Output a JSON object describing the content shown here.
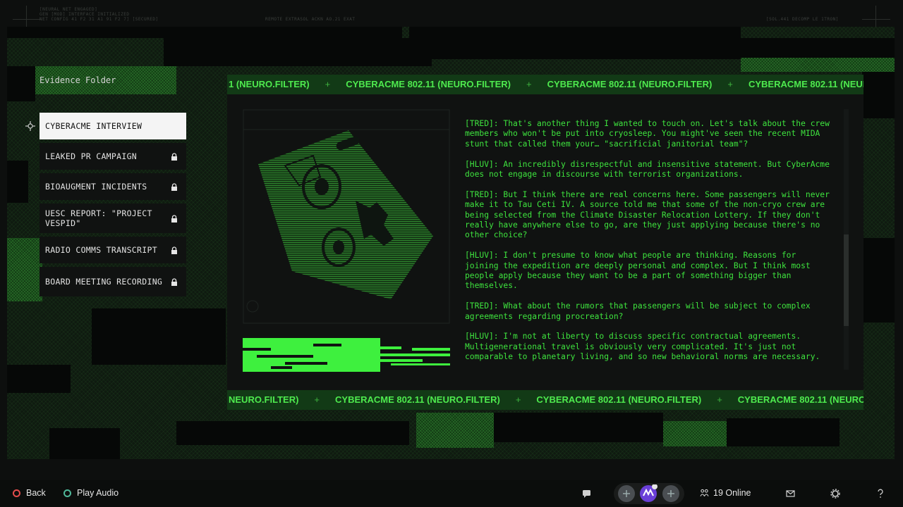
{
  "header": {
    "meta_left": [
      "[NEURAL NET ENGAGED]",
      "GEN [MOD] INTERFACE INITIALIZED",
      "NET CONFIG 41 F2 31 A1 91 F2 7]  [SECURED]"
    ],
    "meta_center": "REMOTE EXTRASOL ACKN AO.21 EXAT",
    "meta_right": "[SOL.441 DECOMP LE 1TRON]"
  },
  "sidebar": {
    "title": "Evidence Folder",
    "items": [
      {
        "label": "CYBERACME INTERVIEW",
        "active": true,
        "locked": false
      },
      {
        "label": "LEAKED PR CAMPAIGN",
        "active": false,
        "locked": true
      },
      {
        "label": "BIOAUGMENT INCIDENTS",
        "active": false,
        "locked": true
      },
      {
        "label": "UESC REPORT: \"PROJECT VESPID\"",
        "active": false,
        "locked": true
      },
      {
        "label": "RADIO COMMS TRANSCRIPT",
        "active": false,
        "locked": true
      },
      {
        "label": "BOARD MEETING RECORDING",
        "active": false,
        "locked": true
      }
    ]
  },
  "ticker": {
    "text": "CYBERACME 802.11 (NEURO.FILTER)",
    "separator": "+"
  },
  "transcript": {
    "paragraphs": [
      "[TRED]: That's another thing I wanted to touch on. Let's talk about the crew members who won't be put into cryosleep. You might've seen the recent MIDA stunt that called them your… \"sacrificial janitorial team\"?",
      "[HLUV]: An incredibly disrespectful and insensitive statement. But CyberAcme does not engage in discourse with terrorist organizations.",
      "[TRED]: But I think there are real concerns here. Some passengers will never make it to Tau Ceti IV. A source told me that some of the non-cryo crew are being selected from the Climate Disaster Relocation Lottery. If they don't really have anywhere else to go, are they just applying because there's no other choice?",
      "[HLUV]: I don't presume to know what people are thinking. Reasons for joining the expedition are deeply personal and complex. But I think most people apply because they want to be a part of something bigger than themselves.",
      "[TRED]: What about the rumors that passengers will be subject to complex agreements regarding procreation?",
      "[HLUV]: I'm not at liberty to discuss specific contractual agreements. Multigenerational travel is obviously very complicated. It's just not comparable to planetary living, and so new behavioral norms are necessary."
    ]
  },
  "footer": {
    "back_label": "Back",
    "play_audio_label": "Play Audio",
    "online_label": "19 Online"
  },
  "colors": {
    "accent_green": "#3ee43e",
    "ticker_bg": "#123a16",
    "active_item_bg": "#f4f4f4"
  }
}
